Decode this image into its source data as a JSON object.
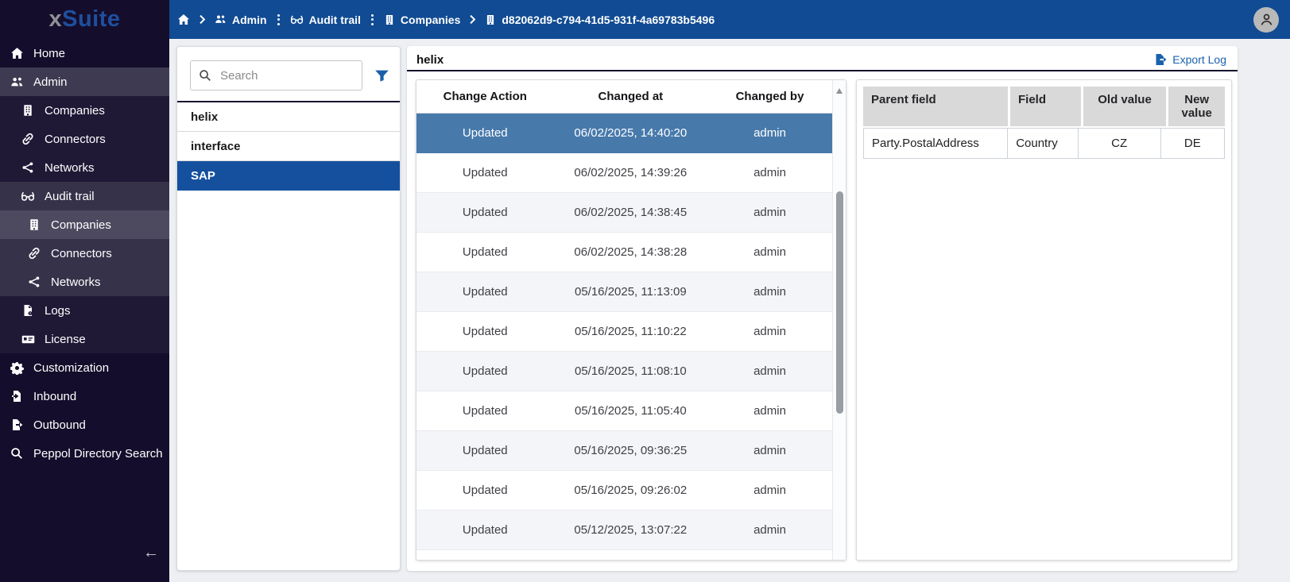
{
  "app": {
    "logo_x": "x",
    "logo_suite": "Suite"
  },
  "topbar": {
    "breadcrumb": {
      "admin": "Admin",
      "audit_trail": "Audit trail",
      "companies": "Companies",
      "company_id": "d82062d9-c794-41d5-931f-4a69783b5496"
    }
  },
  "sidebar": {
    "items": [
      {
        "label": "Home"
      },
      {
        "label": "Admin"
      },
      {
        "label": "Companies"
      },
      {
        "label": "Connectors"
      },
      {
        "label": "Networks"
      },
      {
        "label": "Audit trail"
      },
      {
        "label": "Companies"
      },
      {
        "label": "Connectors"
      },
      {
        "label": "Networks"
      },
      {
        "label": "Logs"
      },
      {
        "label": "License"
      },
      {
        "label": "Customization"
      },
      {
        "label": "Inbound"
      },
      {
        "label": "Outbound"
      },
      {
        "label": "Peppol Directory Search"
      }
    ]
  },
  "company_list": {
    "search_placeholder": "Search",
    "items": [
      {
        "label": "helix"
      },
      {
        "label": "interface"
      },
      {
        "label": "SAP",
        "selected": true
      }
    ]
  },
  "audit": {
    "title": "helix",
    "export_label": "Export Log",
    "columns": [
      "Change Action",
      "Changed at",
      "Changed by"
    ],
    "rows": [
      {
        "action": "Updated",
        "changed_at": "06/02/2025, 14:40:20",
        "changed_by": "admin",
        "selected": true
      },
      {
        "action": "Updated",
        "changed_at": "06/02/2025, 14:39:26",
        "changed_by": "admin"
      },
      {
        "action": "Updated",
        "changed_at": "06/02/2025, 14:38:45",
        "changed_by": "admin"
      },
      {
        "action": "Updated",
        "changed_at": "06/02/2025, 14:38:28",
        "changed_by": "admin"
      },
      {
        "action": "Updated",
        "changed_at": "05/16/2025, 11:13:09",
        "changed_by": "admin"
      },
      {
        "action": "Updated",
        "changed_at": "05/16/2025, 11:10:22",
        "changed_by": "admin"
      },
      {
        "action": "Updated",
        "changed_at": "05/16/2025, 11:08:10",
        "changed_by": "admin"
      },
      {
        "action": "Updated",
        "changed_at": "05/16/2025, 11:05:40",
        "changed_by": "admin"
      },
      {
        "action": "Updated",
        "changed_at": "05/16/2025, 09:36:25",
        "changed_by": "admin"
      },
      {
        "action": "Updated",
        "changed_at": "05/16/2025, 09:26:02",
        "changed_by": "admin"
      },
      {
        "action": "Updated",
        "changed_at": "05/12/2025, 13:07:22",
        "changed_by": "admin"
      }
    ]
  },
  "changes": {
    "columns": [
      "Parent field",
      "Field",
      "Old value",
      "New value"
    ],
    "rows": [
      {
        "parent_field": "Party.PostalAddress",
        "field": "Country",
        "old_value": "CZ",
        "new_value": "DE"
      }
    ]
  },
  "colors": {
    "sidebar_bg": "#140d2b",
    "topbar_bg": "#114b93",
    "selected_company_bg": "#15509e",
    "selected_audit_row_bg": "#4779ab",
    "accent_blue": "#1a61ad",
    "header_rule": "#17122e",
    "alt_row_bg": "#f3f5f8",
    "detail_header_bg": "#d9d9d9"
  }
}
